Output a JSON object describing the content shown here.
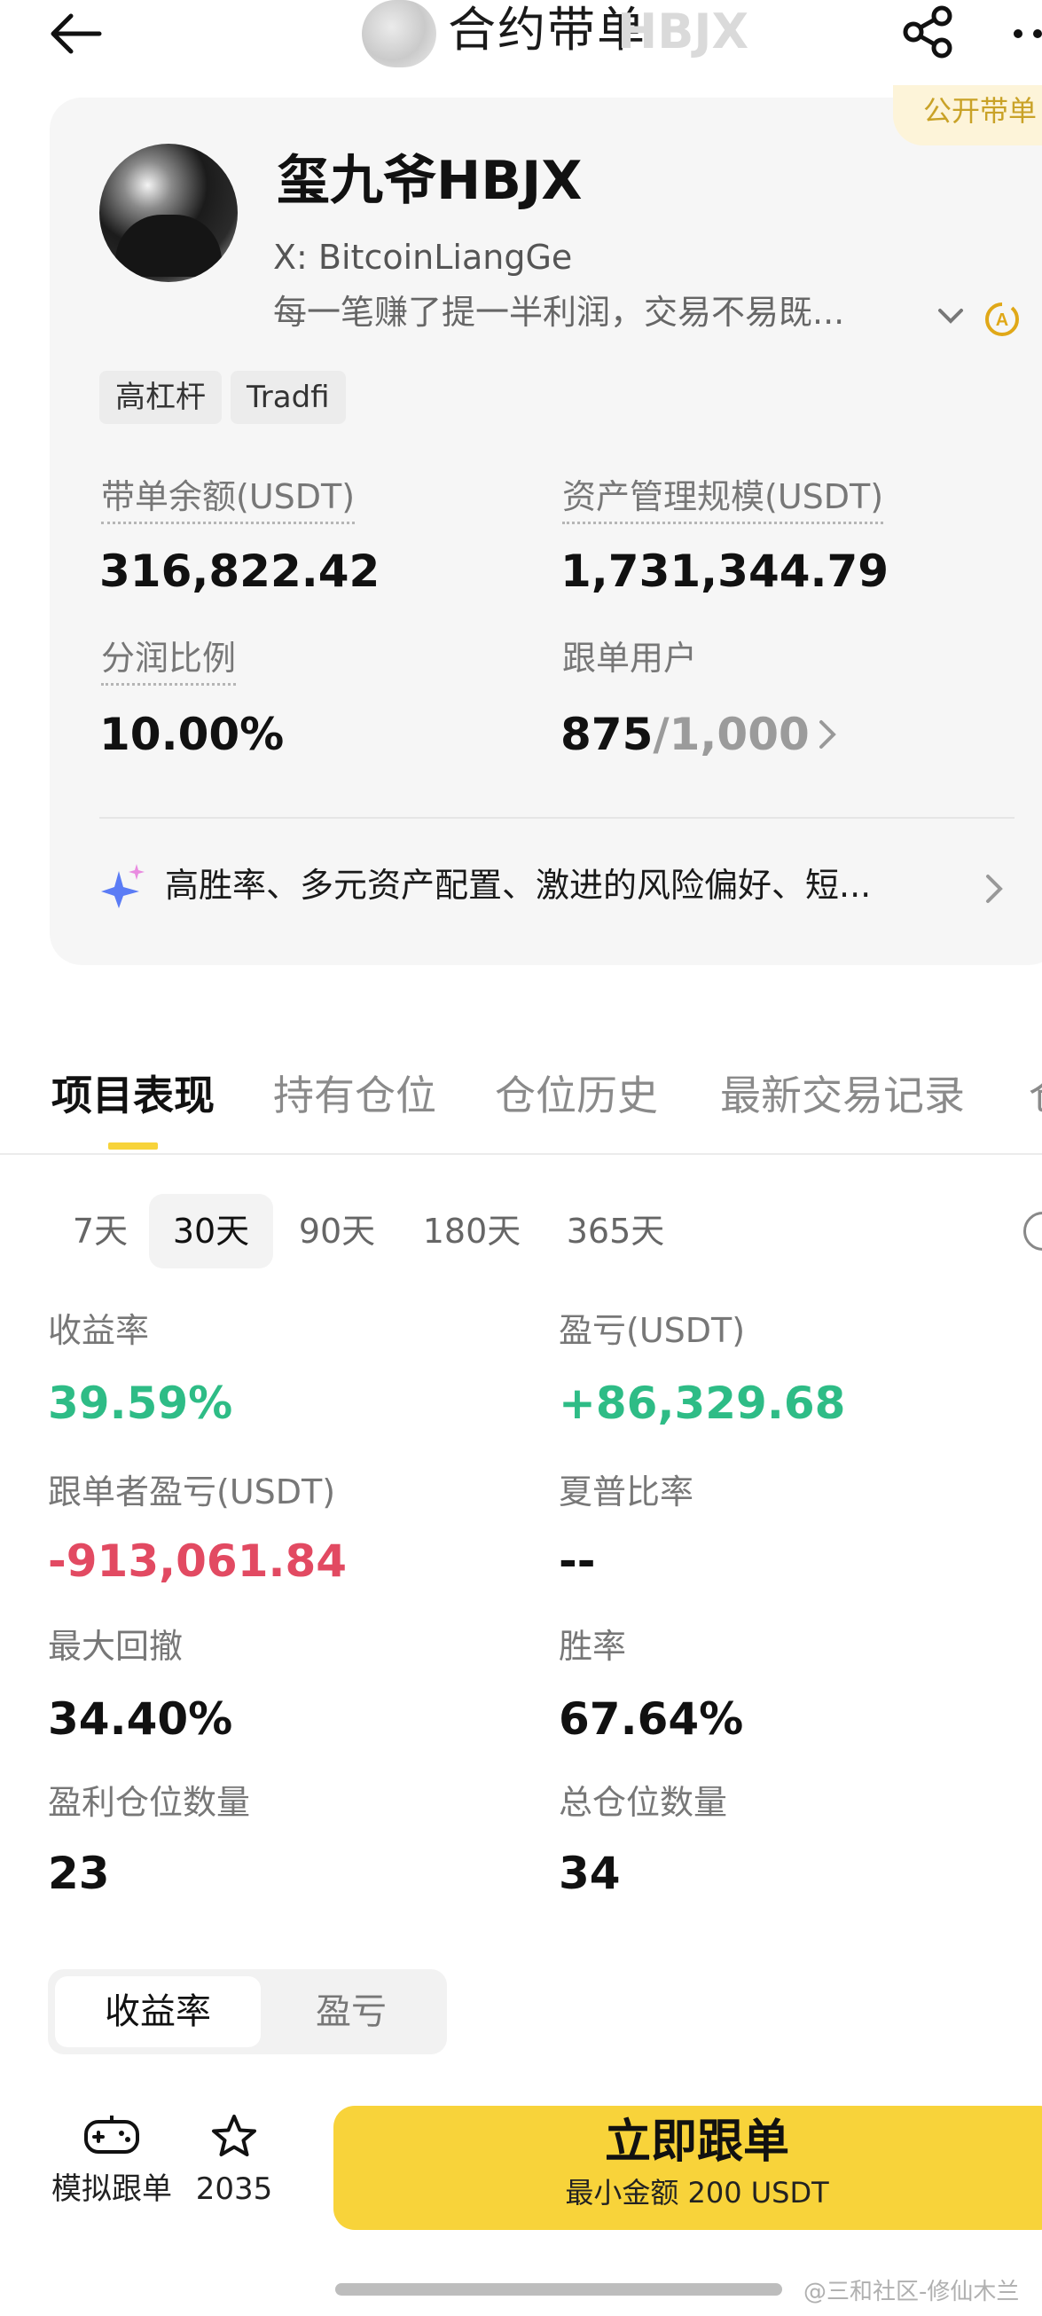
{
  "header": {
    "title": "合约带单",
    "watermark": "HBJX",
    "icons": {
      "back": "back-arrow-icon",
      "share": "share-icon",
      "more": "more-icon"
    }
  },
  "profile": {
    "public_badge": "公开带单",
    "name": "玺九爷HBJX",
    "social": "X: BitcoinLiangGe",
    "bio": "每一笔赚了提一半利润，交易不易既...",
    "tags": [
      "高杠杆",
      "Tradfi"
    ]
  },
  "stats": {
    "balance_label": "带单余额(USDT)",
    "balance_value": "316,822.42",
    "aum_label": "资产管理规模(USDT)",
    "aum_value": "1,731,344.79",
    "share_label": "分润比例",
    "share_value": "10.00%",
    "followers_label": "跟单用户",
    "followers_value": "875",
    "followers_max": "/1,000"
  },
  "ai_summary": "高胜率、多元资产配置、激进的风险偏好、短...",
  "tabs": [
    "项目表现",
    "持有仓位",
    "仓位历史",
    "最新交易记录",
    "仓"
  ],
  "periods": [
    {
      "label": "7天",
      "active": false
    },
    {
      "label": "30天",
      "active": true
    },
    {
      "label": "90天",
      "active": false
    },
    {
      "label": "180天",
      "active": false
    },
    {
      "label": "365天",
      "active": false
    }
  ],
  "metrics": {
    "roi_label": "收益率",
    "roi_value": "39.59%",
    "pnl_label": "盈亏(USDT)",
    "pnl_value": "+86,329.68",
    "follower_pnl_label": "跟单者盈亏(USDT)",
    "follower_pnl_value": "-913,061.84",
    "sharpe_label": "夏普比率",
    "sharpe_value": "--",
    "mdd_label": "最大回撤",
    "mdd_value": "34.40%",
    "winrate_label": "胜率",
    "winrate_value": "67.64%",
    "win_positions_label": "盈利仓位数量",
    "win_positions_value": "23",
    "total_positions_label": "总仓位数量",
    "total_positions_value": "34"
  },
  "chart_toggle": [
    "收益率",
    "盈亏"
  ],
  "actions": {
    "simulate_label": "模拟跟单",
    "favorite_count": "2035",
    "copy_title": "立即跟单",
    "copy_subtitle": "最小金额 200 USDT"
  },
  "footer_watermark": "@三和社区-修仙木兰",
  "colors": {
    "accent_yellow": "#f8d33a",
    "profit_green": "#2ebc86",
    "loss_red": "#e24a62"
  }
}
